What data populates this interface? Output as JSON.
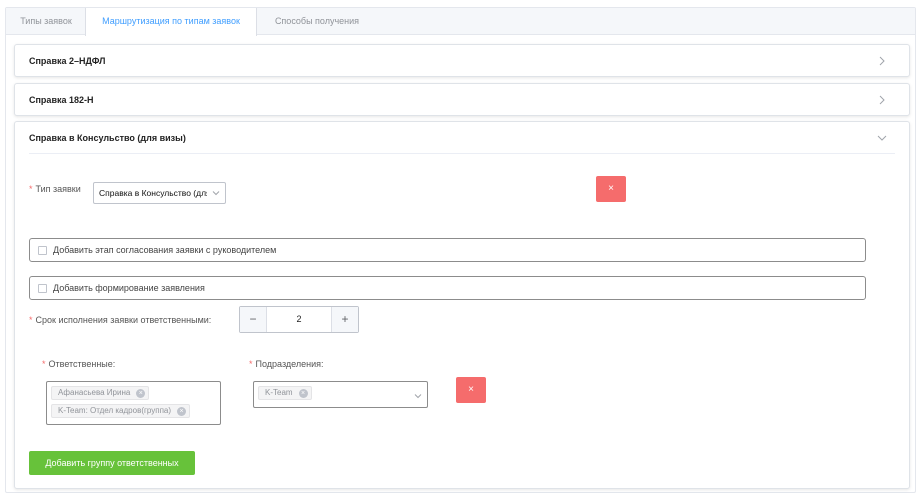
{
  "tabs": [
    {
      "label": "Типы заявок"
    },
    {
      "label": "Маршрутизация по типам заявок"
    },
    {
      "label": "Способы получения"
    }
  ],
  "cards": {
    "ndfl": {
      "title": "Справка 2–НДФЛ",
      "icon": "chevron-right-icon"
    },
    "n182": {
      "title": "Справка 182-Н",
      "icon": "chevron-right-icon"
    },
    "consulate": {
      "title": "Справка в Консульство (для визы)",
      "icon": "chevron-down-icon",
      "request_type": {
        "label": "Тип заявки",
        "value": "Справка в Консульство (для визы)"
      },
      "delete_label": "×",
      "manager_approval": {
        "label": "Добавить этап согласования заявки с руководителем",
        "checked": false
      },
      "statement": {
        "label": "Добавить формирование заявления",
        "checked": false
      },
      "deadline": {
        "label": "Срок исполнения заявки ответственными:",
        "value": "2",
        "minus": "−",
        "plus": "+"
      },
      "responsible": {
        "label": "Ответственные:",
        "chips": [
          "Афанасьева Ирина",
          "K-Team: Отдел кадров(группа)"
        ]
      },
      "departments": {
        "label": "Подразделения:",
        "chips": [
          "K-Team"
        ]
      },
      "add_group_label": "Добавить группу ответственных"
    }
  },
  "required_mark": "*",
  "chip_close": "×",
  "colors": {
    "accent": "#409eff",
    "danger": "#f56c6c",
    "success": "#67c23a"
  }
}
